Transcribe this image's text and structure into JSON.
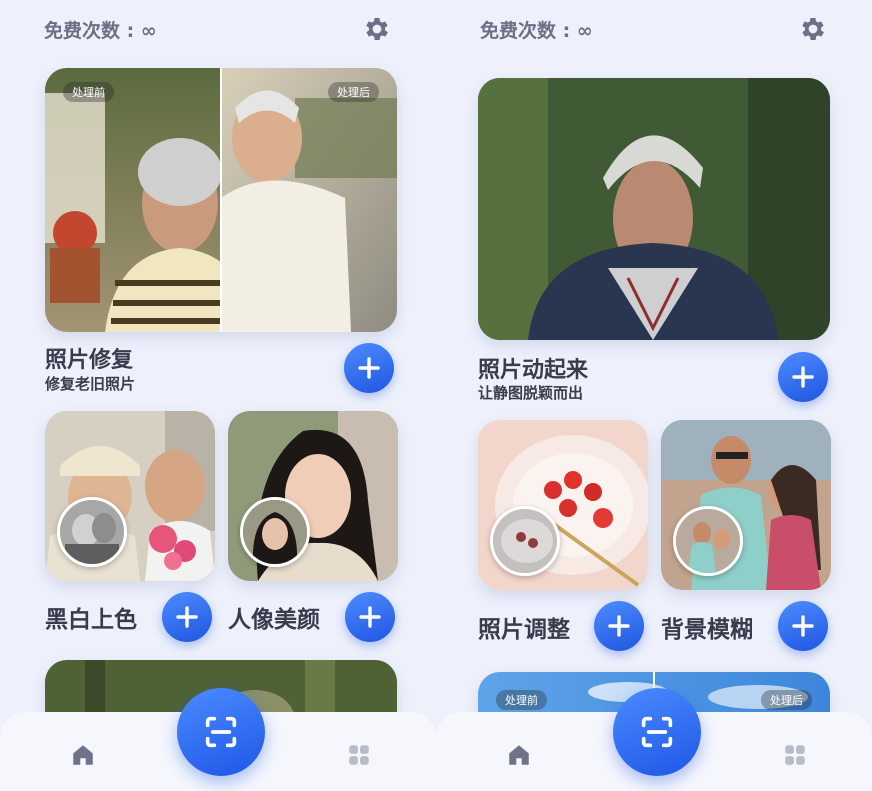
{
  "screens": [
    {
      "free_count": "免费次数 : ∞",
      "main_card": {
        "title": "照片修复",
        "subtitle": "修复老旧照片",
        "before_label": "处理前",
        "after_label": "处理后"
      },
      "tiles": [
        {
          "label": "黑白上色"
        },
        {
          "label": "人像美颜"
        }
      ]
    },
    {
      "free_count": "免费次数 : ∞",
      "main_card": {
        "title": "照片动起来",
        "subtitle": "让静图脱颖而出"
      },
      "tiles": [
        {
          "label": "照片调整"
        },
        {
          "label": "背景模糊"
        }
      ],
      "preview_card": {
        "before_label": "处理前",
        "after_label": "处理后"
      }
    }
  ],
  "nav": {
    "items": [
      "home-icon",
      "scan-icon",
      "apps-grid-icon"
    ]
  },
  "colors": {
    "accent": "#2f6bf0",
    "background": "#eef1fb",
    "text": "#3a3c4c",
    "muted": "#6b7086"
  }
}
